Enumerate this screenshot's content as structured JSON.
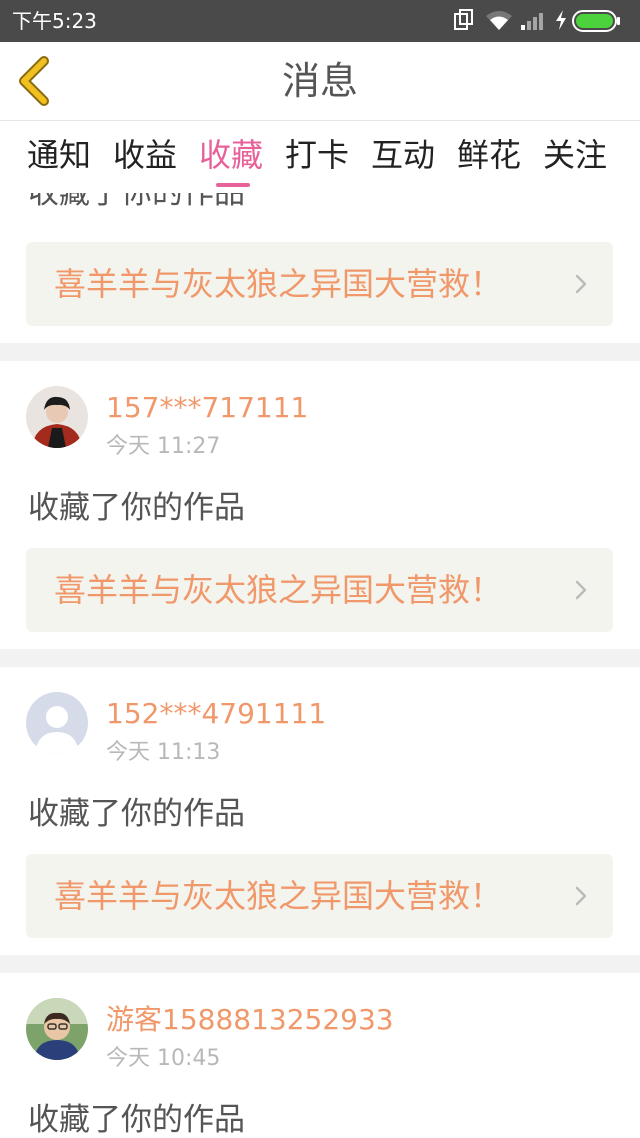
{
  "status_bar": {
    "time": "下午5:23",
    "icons": [
      "copy-icon",
      "wifi-icon",
      "signal-icon",
      "charging-icon",
      "battery-icon"
    ]
  },
  "header": {
    "title": "消息",
    "back_icon": "chevron-left-icon"
  },
  "tabs": {
    "items": [
      {
        "label": "通知"
      },
      {
        "label": "收益"
      },
      {
        "label": "收藏"
      },
      {
        "label": "打卡"
      },
      {
        "label": "互动"
      },
      {
        "label": "鲜花"
      },
      {
        "label": "关注"
      }
    ],
    "active": "收藏"
  },
  "messages": [
    {
      "action": "收藏了你的作品",
      "work_title": "喜羊羊与灰太狼之异国大营救！"
    },
    {
      "username": "157***717111",
      "time": "今天 11:27",
      "action": "收藏了你的作品",
      "work_title": "喜羊羊与灰太狼之异国大营救！"
    },
    {
      "username": "152***4791111",
      "time": "今天 11:13",
      "action": "收藏了你的作品",
      "work_title": "喜羊羊与灰太狼之异国大营救！"
    },
    {
      "username": "游客1588813252933",
      "time": "今天 10:45",
      "action": "收藏了你的作品"
    }
  ],
  "colors": {
    "accent_pink": "#e8629a",
    "orange_text": "#f0986a",
    "back_arrow": "#f0c020",
    "status_bar_bg": "#4a4a4a",
    "card_bg": "#f4f4ef"
  }
}
